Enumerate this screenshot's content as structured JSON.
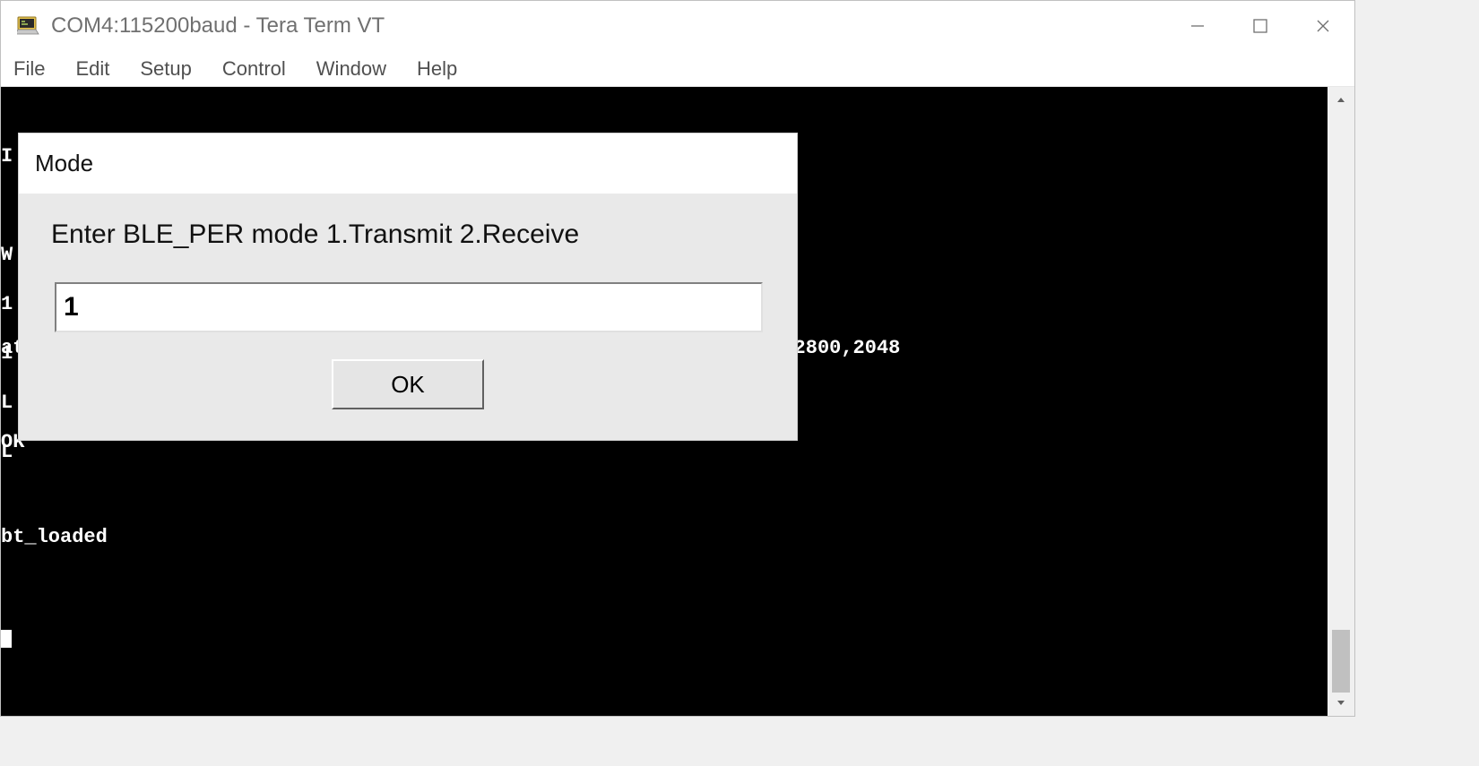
{
  "window": {
    "title": "COM4:115200baud - Tera Term VT"
  },
  "menu": {
    "file": "File",
    "edit": "Edit",
    "setup": "Setup",
    "control": "Control",
    "window": "Window",
    "help": "Help"
  },
  "terminal": {
    "edge_letters": "I\n\nW\n1\n1\nL\nL",
    "line1": "at+rsi_opermode=851968,0,1,2147483648,2150629376,3221225472,0,376012800,2048",
    "line2": "OK",
    "line3": "bt_loaded"
  },
  "modal": {
    "title": "Mode",
    "prompt": "Enter BLE_PER mode 1.Transmit 2.Receive",
    "input_value": "1",
    "ok_label": "OK"
  }
}
